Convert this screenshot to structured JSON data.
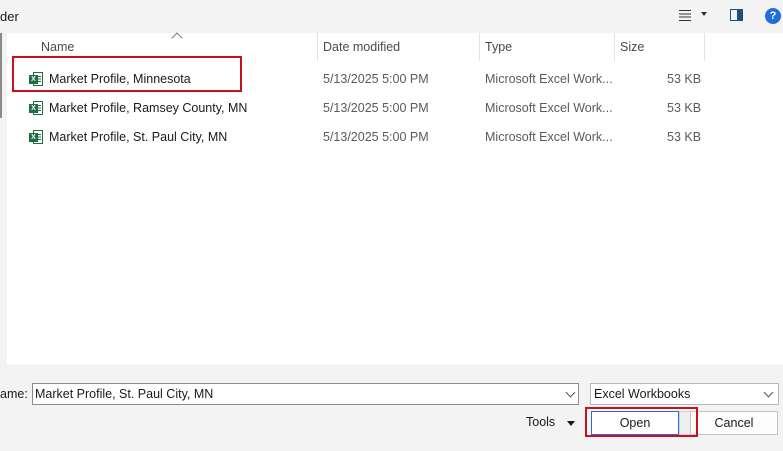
{
  "header": {
    "crumb_fragment": "der"
  },
  "list": {
    "columns": [
      {
        "key": "name",
        "label": "Name"
      },
      {
        "key": "date",
        "label": "Date modified"
      },
      {
        "key": "type",
        "label": "Type"
      },
      {
        "key": "size",
        "label": "Size"
      }
    ],
    "files": [
      {
        "name": "Market Profile, Minnesota",
        "date": "5/13/2025 5:00 PM",
        "type": "Microsoft Excel Work...",
        "size": "53 KB"
      },
      {
        "name": "Market Profile, Ramsey County, MN",
        "date": "5/13/2025 5:00 PM",
        "type": "Microsoft Excel Work...",
        "size": "53 KB"
      },
      {
        "name": "Market Profile, St. Paul City, MN",
        "date": "5/13/2025 5:00 PM",
        "type": "Microsoft Excel Work...",
        "size": "53 KB"
      }
    ]
  },
  "footer": {
    "filename_label": "ame:",
    "filename_value": "Market Profile, St. Paul City, MN",
    "filetype_value": "Excel Workbooks",
    "tools_label": "Tools",
    "open_label": "Open",
    "cancel_label": "Cancel"
  },
  "icons": {
    "view": "view-menu-icon",
    "preview": "preview-pane-icon",
    "help": "help-icon",
    "file": "excel-file-icon"
  },
  "colors": {
    "highlight": "#c8101e",
    "accent": "#1e6fd9",
    "excel": "#1d6f42"
  }
}
